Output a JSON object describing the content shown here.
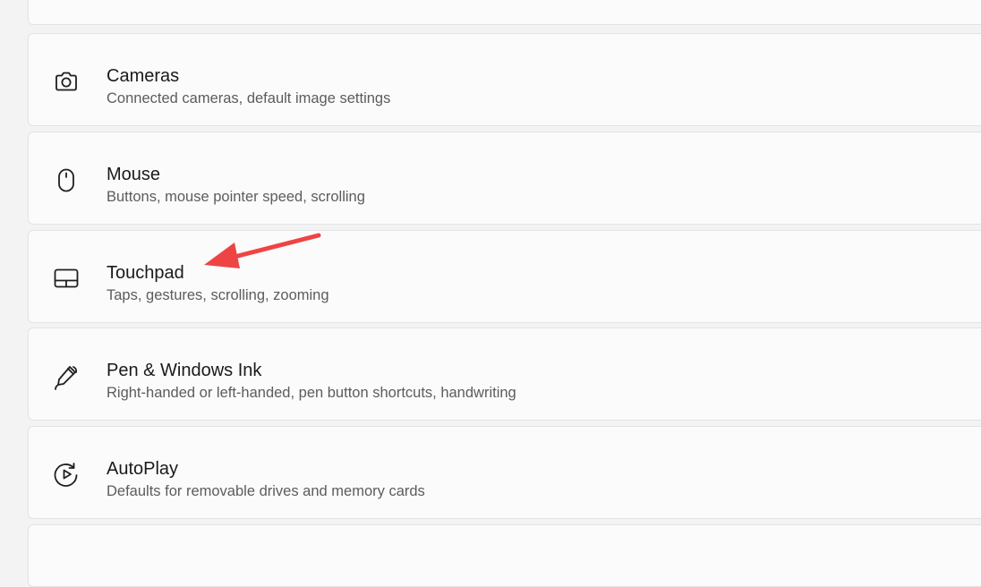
{
  "settings_items": [
    {
      "icon": "camera-icon",
      "title": "Cameras",
      "subtitle": "Connected cameras, default image settings"
    },
    {
      "icon": "mouse-icon",
      "title": "Mouse",
      "subtitle": "Buttons, mouse pointer speed, scrolling"
    },
    {
      "icon": "touchpad-icon",
      "title": "Touchpad",
      "subtitle": "Taps, gestures, scrolling, zooming"
    },
    {
      "icon": "pen-icon",
      "title": "Pen & Windows Ink",
      "subtitle": "Right-handed or left-handed, pen button shortcuts, handwriting"
    },
    {
      "icon": "autoplay-icon",
      "title": "AutoPlay",
      "subtitle": "Defaults for removable drives and memory cards"
    }
  ],
  "annotation": {
    "type": "arrow",
    "color": "#ef4444",
    "points_to": "Touchpad"
  }
}
